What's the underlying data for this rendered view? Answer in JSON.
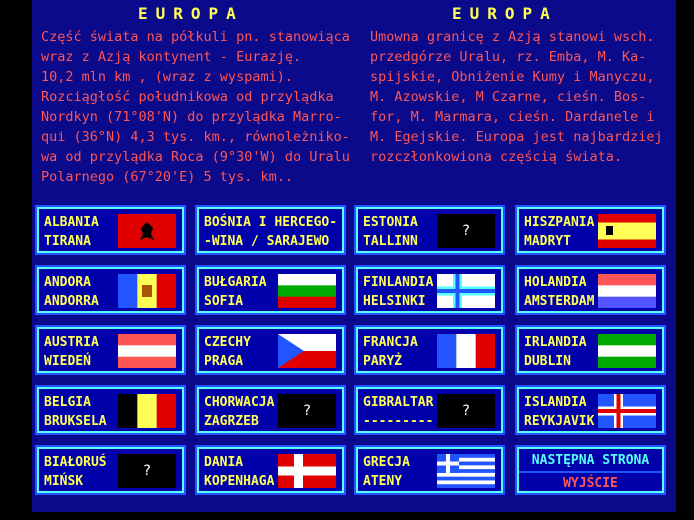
{
  "left_title": "EUROPA",
  "right_title": "EUROPA",
  "left_text": "Część świata na półkuli pn. stanowiąca\nwraz z Azją kontynent - Eurazję.\n10,2 mln km , (wraz z wyspami).\nRozciągłość południkowa od przylądka\nNordkyn (71°08'N) do przylądka Marro-\nqui (36°N) 4,3 tys. km., równoleżniko-\nwa od przylądka Roca (9°30'W) do Uralu\nPolarnego (67°20'E) 5 tys. km..",
  "right_text": "Umowna granicę z Azją stanowi wsch.\nprzedgórze Uralu, rz. Emba, M. Ka-\nspijskie, Obniżenie Kumy i Manyczu,\nM. Azowskie, M Czarne, cieśn. Bos-\nfor, M. Marmara, cieśn. Dardanele i\nM. Egejskie. Europa jest najbardziej\nrozczłonkowiona częścią świata.",
  "countries": [
    {
      "line1": "ALBANIA",
      "line2": "TIRANA",
      "flag": "albania"
    },
    {
      "line1": "BOŚNIA I HERCEGO-",
      "line2": "-WINA / SARAJEWO",
      "flag": "none"
    },
    {
      "line1": "ESTONIA",
      "line2": "TALLINN",
      "flag": "unknown"
    },
    {
      "line1": "HISZPANIA",
      "line2": "MADRYT",
      "flag": "spain"
    },
    {
      "line1": "ANDORA",
      "line2": "ANDORRA",
      "flag": "andorra"
    },
    {
      "line1": "BUŁGARIA",
      "line2": "SOFIA",
      "flag": "bulgaria"
    },
    {
      "line1": "FINLANDIA",
      "line2": "HELSINKI",
      "flag": "finland"
    },
    {
      "line1": "HOLANDIA",
      "line2": "AMSTERDAM",
      "flag": "netherlands"
    },
    {
      "line1": "AUSTRIA",
      "line2": "WIEDEŃ",
      "flag": "austria"
    },
    {
      "line1": "CZECHY",
      "line2": "PRAGA",
      "flag": "czech"
    },
    {
      "line1": "FRANCJA",
      "line2": "PARYŻ",
      "flag": "france"
    },
    {
      "line1": "IRLANDIA",
      "line2": "DUBLIN",
      "flag": "ireland"
    },
    {
      "line1": "BELGIA",
      "line2": "BRUKSELA",
      "flag": "belgium"
    },
    {
      "line1": "CHORWACJA",
      "line2": "ZAGRZEB",
      "flag": "unknown"
    },
    {
      "line1": "GIBRALTAR",
      "line2": "---------",
      "flag": "unknown"
    },
    {
      "line1": "ISLANDIA",
      "line2": "REYKJAVIK",
      "flag": "iceland"
    },
    {
      "line1": "BIAŁORUŚ",
      "line2": "MIŃSK",
      "flag": "unknown"
    },
    {
      "line1": "DANIA",
      "line2": "KOPENHAGA",
      "flag": "denmark"
    },
    {
      "line1": "GRECJA",
      "line2": "ATENY",
      "flag": "greece"
    }
  ],
  "unknown_mark": "?",
  "next_page_label": "NASTĘPNA STRONA",
  "exit_label": "WYJŚCIE",
  "colors": {
    "background": "#0a0a8a",
    "title": "#ffff55",
    "text": "#ff5555",
    "card_border": "#55ffff",
    "next": "#55ffff",
    "exit": "#ff5555"
  }
}
